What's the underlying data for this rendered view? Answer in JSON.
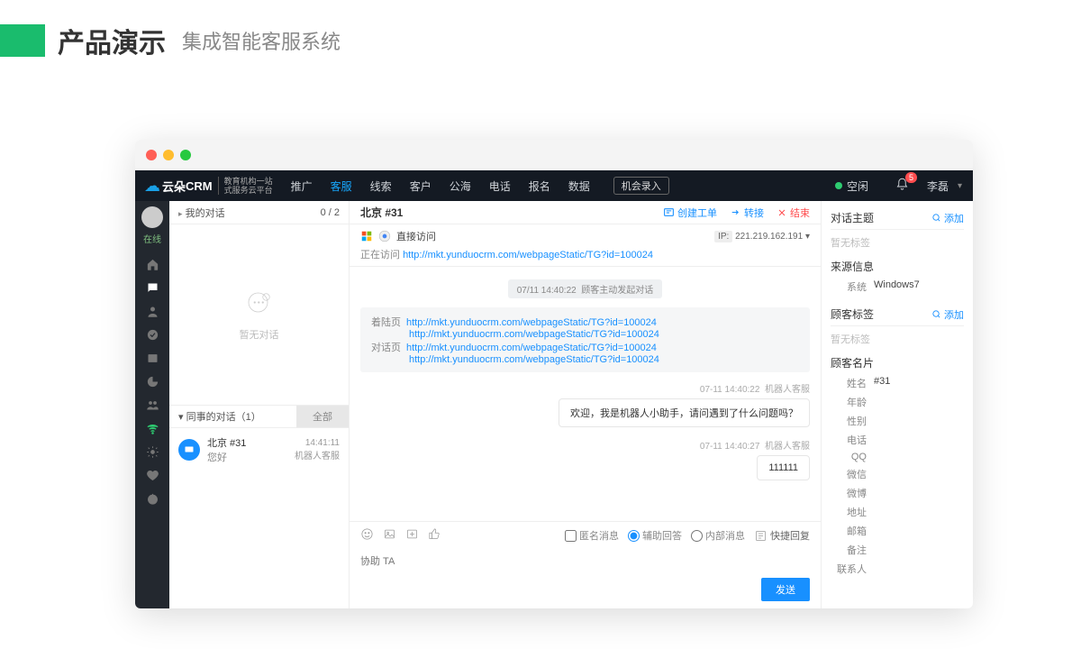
{
  "slide": {
    "title": "产品演示",
    "subtitle": "集成智能客服系统"
  },
  "topbar": {
    "logo1": "云朵",
    "logo2": "CRM",
    "tagline1": "教育机构一站",
    "tagline2": "式服务云平台",
    "nav": [
      "推广",
      "客服",
      "线索",
      "客户",
      "公海",
      "电话",
      "报名",
      "数据",
      "机会录入"
    ],
    "status": "空闲",
    "bell_count": "5",
    "user": "李磊"
  },
  "rail": {
    "online": "在线"
  },
  "left": {
    "my_conv": "我的对话",
    "my_count": "0 / 2",
    "empty": "暂无对话",
    "col_conv": "同事的对话（1）",
    "all": "全部",
    "item": {
      "title": "北京 #31",
      "preview": "您好",
      "time": "14:41:11",
      "agent": "机器人客服"
    }
  },
  "chat": {
    "title": "北京 #31",
    "actions": {
      "ticket": "创建工单",
      "transfer": "转接",
      "end": "结束"
    },
    "visit_type": "直接访问",
    "ip_label": "IP:",
    "ip": "221.219.162.191",
    "visiting_label": "正在访问 ",
    "visiting_url": "http://mkt.yunduocrm.com/webpageStatic/TG?id=100024",
    "sys_time": "07/11 14:40:22",
    "sys_text": "顾客主动发起对话",
    "ref": {
      "landing_label": "着陆页",
      "chat_label": "对话页",
      "urls": [
        "http://mkt.yunduocrm.com/webpageStatic/TG?id=100024",
        "http://mkt.yunduocrm.com/webpageStatic/TG?id=100024",
        "http://mkt.yunduocrm.com/webpageStatic/TG?id=100024",
        "http://mkt.yunduocrm.com/webpageStatic/TG?id=100024"
      ]
    },
    "msgs": [
      {
        "time": "07-11 14:40:22",
        "sender": "机器人客服",
        "text": "欢迎，我是机器人小助手，请问遇到了什么问题吗？"
      },
      {
        "time": "07-11 14:40:27",
        "sender": "机器人客服",
        "text": "111111"
      }
    ]
  },
  "composer": {
    "anon": "匿名消息",
    "assist": "辅助回答",
    "internal": "内部消息",
    "quick": "快捷回复",
    "placeholder": "协助 TA",
    "send": "发送"
  },
  "right": {
    "topic_title": "对话主题",
    "add": "添加",
    "no_tag": "暂无标签",
    "source_title": "来源信息",
    "sys_label": "系统",
    "sys_value": "Windows7",
    "tags_title": "顾客标签",
    "card_title": "顾客名片",
    "card": [
      {
        "k": "姓名",
        "v": "#31"
      },
      {
        "k": "年龄",
        "v": ""
      },
      {
        "k": "性别",
        "v": ""
      },
      {
        "k": "电话",
        "v": ""
      },
      {
        "k": "QQ",
        "v": ""
      },
      {
        "k": "微信",
        "v": ""
      },
      {
        "k": "微博",
        "v": ""
      },
      {
        "k": "地址",
        "v": ""
      },
      {
        "k": "邮箱",
        "v": ""
      },
      {
        "k": "备注",
        "v": ""
      },
      {
        "k": "联系人",
        "v": ""
      }
    ]
  }
}
